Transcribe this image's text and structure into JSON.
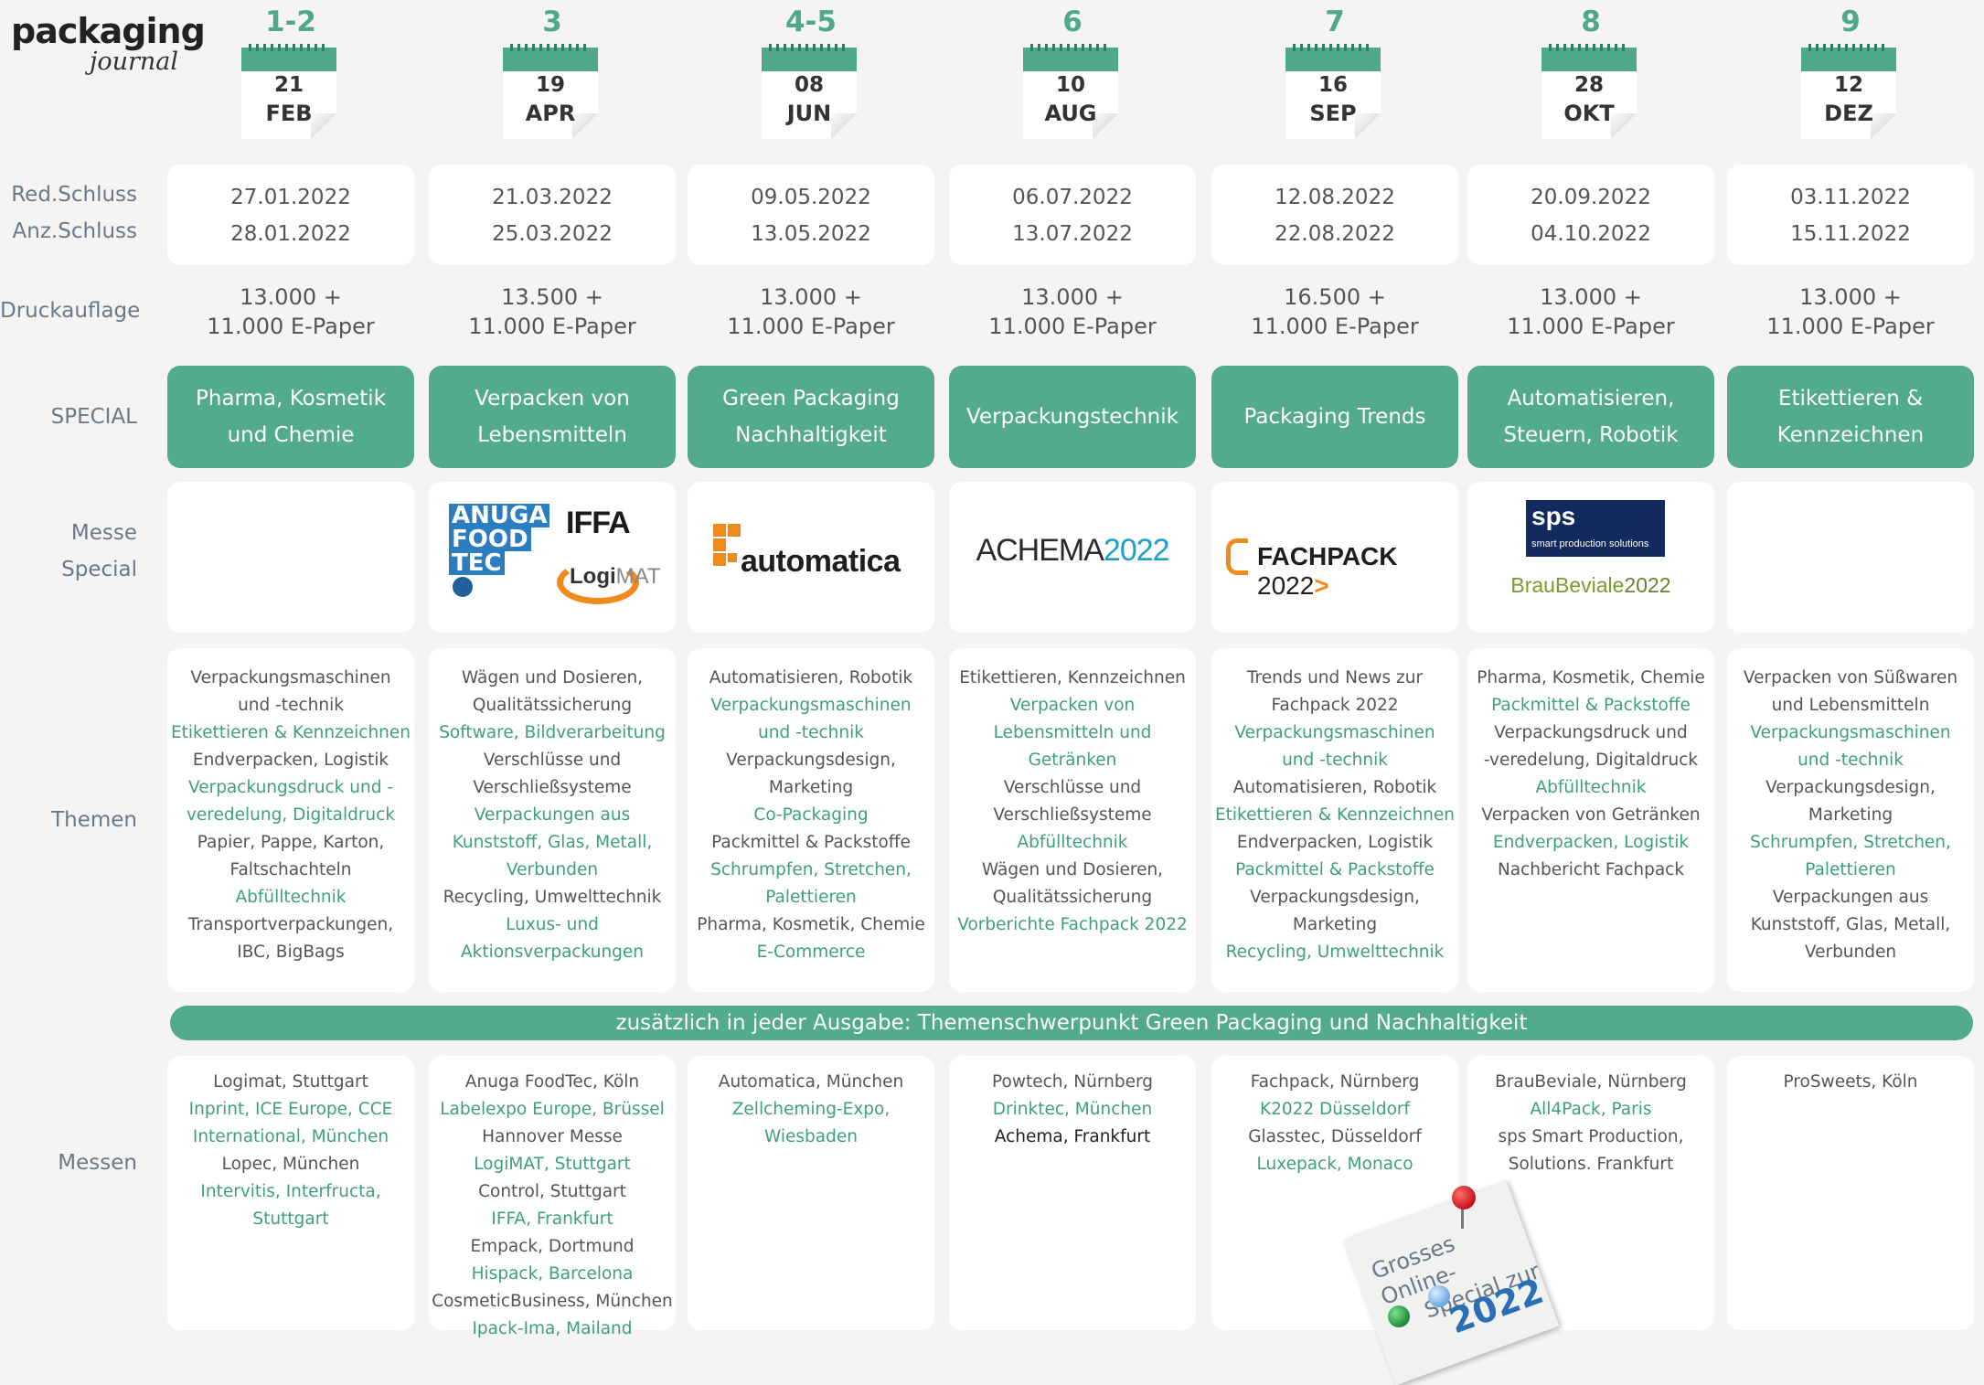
{
  "logo": {
    "line1": "packaging",
    "line2": "journal"
  },
  "row_labels": {
    "red": "Red.Schluss",
    "anz": "Anz.Schluss",
    "druck": "Druckauflage",
    "special": "SPECIAL",
    "messe1": "Messe",
    "messe2": "Special",
    "themen": "Themen",
    "messen": "Messen"
  },
  "band": "zusätzlich in jeder Ausgabe: Themenschwerpunkt Green Packaging und Nachhaltigkeit",
  "logos": {
    "anuga": [
      "ANUGA",
      "FOOD",
      "TEC"
    ],
    "iffa": "IFFA",
    "logimat_a": "Logi",
    "logimat_b": "MAT",
    "automatica": "automatica",
    "achema_a": "ACHEMA",
    "achema_b": "2022",
    "fachpack_a": "FACHPACK",
    "fachpack_b": "2022",
    "fachpack_c": ">",
    "sps_a": "sps",
    "sps_b": "smart production solutions",
    "brau_a": "BrauBeviale",
    "brau_b": "2022"
  },
  "note": {
    "line1": "Grosses Online-",
    "line2": "Special zur",
    "year": "2022"
  },
  "issues": [
    {
      "num": "1-2",
      "day": "21",
      "month": "FEB",
      "red": "27.01.2022",
      "anz": "28.01.2022",
      "druck1": "13.000 +",
      "druck2": "11.000 E-Paper",
      "special": [
        "Pharma, Kosmetik",
        "und Chemie"
      ],
      "themen": [
        [
          "Verpackungsmaschinen",
          "k"
        ],
        [
          "und -technik",
          "k"
        ],
        [
          "Etikettieren & Kennzeichnen",
          "g"
        ],
        [
          "Endverpacken, Logistik",
          "k"
        ],
        [
          "Verpackungsdruck und -",
          "g"
        ],
        [
          "veredelung, Digitaldruck",
          "g"
        ],
        [
          "Papier, Pappe, Karton,",
          "k"
        ],
        [
          "Faltschachteln",
          "k"
        ],
        [
          "Abfülltechnik",
          "g"
        ],
        [
          "Transportverpackungen,",
          "k"
        ],
        [
          "IBC, BigBags",
          "k"
        ]
      ],
      "messen": [
        [
          "Logimat, Stuttgart",
          "k"
        ],
        [
          "Inprint, ICE Europe, CCE",
          "g"
        ],
        [
          "International, München",
          "g"
        ],
        [
          "Lopec, München",
          "k"
        ],
        [
          "Intervitis, Interfructa,",
          "g"
        ],
        [
          "Stuttgart",
          "g"
        ]
      ]
    },
    {
      "num": "3",
      "day": "19",
      "month": "APR",
      "red": "21.03.2022",
      "anz": "25.03.2022",
      "druck1": "13.500 +",
      "druck2": "11.000 E-Paper",
      "special": [
        "Verpacken von",
        "Lebensmitteln"
      ],
      "themen": [
        [
          "Wägen und Dosieren,",
          "k"
        ],
        [
          "Qualitätssicherung",
          "k"
        ],
        [
          "Software, Bildverarbeitung",
          "g"
        ],
        [
          "Verschlüsse und",
          "k"
        ],
        [
          "Verschließsysteme",
          "k"
        ],
        [
          "Verpackungen aus",
          "g"
        ],
        [
          "Kunststoff, Glas, Metall,",
          "g"
        ],
        [
          "Verbunden",
          "g"
        ],
        [
          "Recycling, Umwelttechnik",
          "k"
        ],
        [
          "Luxus- und",
          "g"
        ],
        [
          "Aktionsverpackungen",
          "g"
        ]
      ],
      "messen": [
        [
          "Anuga FoodTec, Köln",
          "k"
        ],
        [
          "Labelexpo Europe, Brüssel",
          "g"
        ],
        [
          "Hannover Messe",
          "k"
        ],
        [
          "LogiMAT, Stuttgart",
          "g"
        ],
        [
          "Control, Stuttgart",
          "k"
        ],
        [
          "IFFA, Frankfurt",
          "g"
        ],
        [
          "Empack, Dortmund",
          "k"
        ],
        [
          "Hispack, Barcelona",
          "g"
        ],
        [
          "CosmeticBusiness, München",
          "k"
        ],
        [
          "Ipack-Ima, Mailand",
          "g"
        ]
      ]
    },
    {
      "num": "4-5",
      "day": "08",
      "month": "JUN",
      "red": "09.05.2022",
      "anz": "13.05.2022",
      "druck1": "13.000 +",
      "druck2": "11.000 E-Paper",
      "special": [
        "Green Packaging",
        "Nachhaltigkeit"
      ],
      "themen": [
        [
          "Automatisieren, Robotik",
          "k"
        ],
        [
          "Verpackungsmaschinen",
          "g"
        ],
        [
          "und -technik",
          "g"
        ],
        [
          "Verpackungsdesign,",
          "k"
        ],
        [
          "Marketing",
          "k"
        ],
        [
          "Co-Packaging",
          "g"
        ],
        [
          "Packmittel & Packstoffe",
          "k"
        ],
        [
          "Schrumpfen, Stretchen,",
          "g"
        ],
        [
          "Palettieren",
          "g"
        ],
        [
          "Pharma, Kosmetik, Chemie",
          "k"
        ],
        [
          "E-Commerce",
          "g"
        ]
      ],
      "messen": [
        [
          "Automatica, München",
          "k"
        ],
        [
          "Zellcheming-Expo,",
          "g"
        ],
        [
          "Wiesbaden",
          "g"
        ]
      ]
    },
    {
      "num": "6",
      "day": "10",
      "month": "AUG",
      "red": "06.07.2022",
      "anz": "13.07.2022",
      "druck1": "13.000 +",
      "druck2": "11.000 E-Paper",
      "special": [
        "Verpackungstechnik"
      ],
      "themen": [
        [
          "Etikettieren, Kennzeichnen",
          "k"
        ],
        [
          "Verpacken von",
          "g"
        ],
        [
          "Lebensmitteln und",
          "g"
        ],
        [
          "Getränken",
          "g"
        ],
        [
          "Verschlüsse und",
          "k"
        ],
        [
          "Verschließsysteme",
          "k"
        ],
        [
          "Abfülltechnik",
          "g"
        ],
        [
          "Wägen und Dosieren,",
          "k"
        ],
        [
          "Qualitätssicherung",
          "k"
        ],
        [
          "Vorberichte Fachpack 2022",
          "g"
        ]
      ],
      "messen": [
        [
          "Powtech, Nürnberg",
          "k"
        ],
        [
          "Drinktec, München",
          "g"
        ],
        [
          "Achema, Frankfurt",
          "kk"
        ]
      ]
    },
    {
      "num": "7",
      "day": "16",
      "month": "SEP",
      "red": "12.08.2022",
      "anz": "22.08.2022",
      "druck1": "16.500 +",
      "druck2": "11.000 E-Paper",
      "special": [
        "Packaging Trends"
      ],
      "themen": [
        [
          "Trends und News zur",
          "k"
        ],
        [
          "Fachpack 2022",
          "k"
        ],
        [
          "Verpackungsmaschinen",
          "g"
        ],
        [
          "und -technik",
          "g"
        ],
        [
          "Automatisieren, Robotik",
          "k"
        ],
        [
          "Etikettieren & Kennzeichnen",
          "g"
        ],
        [
          "Endverpacken, Logistik",
          "k"
        ],
        [
          "Packmittel & Packstoffe",
          "g"
        ],
        [
          "Verpackungsdesign,",
          "k"
        ],
        [
          "Marketing",
          "k"
        ],
        [
          "Recycling, Umwelttechnik",
          "g"
        ]
      ],
      "messen": [
        [
          "Fachpack, Nürnberg",
          "k"
        ],
        [
          "K2022 Düsseldorf",
          "g"
        ],
        [
          "Glasstec, Düsseldorf",
          "k"
        ],
        [
          "Luxepack, Monaco",
          "g"
        ]
      ]
    },
    {
      "num": "8",
      "day": "28",
      "month": "OKT",
      "red": "20.09.2022",
      "anz": "04.10.2022",
      "druck1": "13.000 +",
      "druck2": "11.000 E-Paper",
      "special": [
        "Automatisieren,",
        "Steuern, Robotik"
      ],
      "themen": [
        [
          "Pharma, Kosmetik, Chemie",
          "k"
        ],
        [
          "Packmittel & Packstoffe",
          "g"
        ],
        [
          "Verpackungsdruck und",
          "k"
        ],
        [
          "-veredelung, Digitaldruck",
          "k"
        ],
        [
          "Abfülltechnik",
          "g"
        ],
        [
          "Verpacken von Getränken",
          "k"
        ],
        [
          "Endverpacken, Logistik",
          "g"
        ],
        [
          "Nachbericht Fachpack",
          "k"
        ]
      ],
      "messen": [
        [
          "BrauBeviale, Nürnberg",
          "k"
        ],
        [
          "All4Pack, Paris",
          "g"
        ],
        [
          "sps Smart Production,",
          "k"
        ],
        [
          "Solutions. Frankfurt",
          "k"
        ]
      ]
    },
    {
      "num": "9",
      "day": "12",
      "month": "DEZ",
      "red": "03.11.2022",
      "anz": "15.11.2022",
      "druck1": "13.000 +",
      "druck2": "11.000 E-Paper",
      "special": [
        "Etikettieren &",
        "Kennzeichnen"
      ],
      "themen": [
        [
          "Verpacken von Süßwaren",
          "k"
        ],
        [
          "und Lebensmitteln",
          "k"
        ],
        [
          "Verpackungsmaschinen",
          "g"
        ],
        [
          "und -technik",
          "g"
        ],
        [
          "Verpackungsdesign,",
          "k"
        ],
        [
          "Marketing",
          "k"
        ],
        [
          "Schrumpfen, Stretchen,",
          "g"
        ],
        [
          "Palettieren",
          "g"
        ],
        [
          "Verpackungen aus",
          "k"
        ],
        [
          "Kunststoff, Glas, Metall,",
          "k"
        ],
        [
          "Verbunden",
          "k"
        ]
      ],
      "messen": [
        [
          "ProSweets, Köln",
          "k"
        ]
      ]
    }
  ]
}
